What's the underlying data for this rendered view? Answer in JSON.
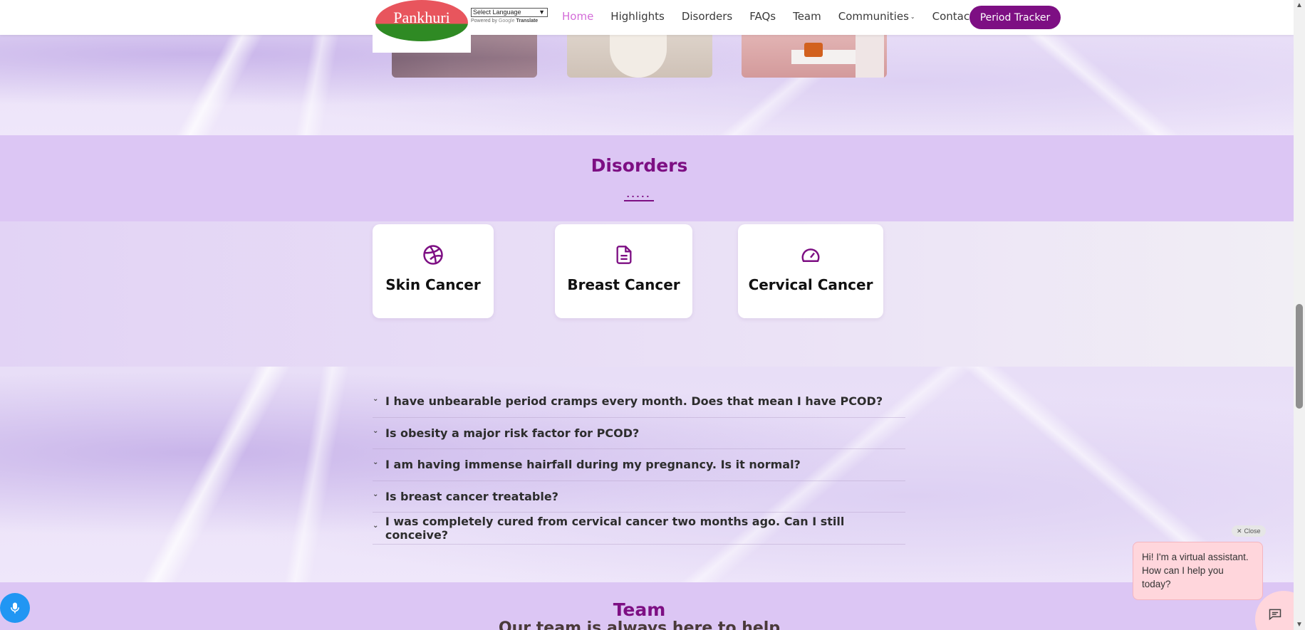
{
  "header": {
    "logo_text": "Pankhuri",
    "translate": {
      "select_label": "Select Language",
      "powered_by": "Powered by",
      "google": "Google",
      "translate": "Translate"
    },
    "nav": [
      {
        "label": "Home",
        "active": true
      },
      {
        "label": "Highlights"
      },
      {
        "label": "Disorders"
      },
      {
        "label": "FAQs"
      },
      {
        "label": "Team"
      },
      {
        "label": "Communities",
        "has_dropdown": true
      },
      {
        "label": "Contact Us"
      }
    ],
    "cta_label": "Period Tracker"
  },
  "colors": {
    "brand": "#7d0f83",
    "active_nav": "#d36bd8",
    "band": "#dcc6f4",
    "mic": "#2196f3",
    "chat_bubble": "#ffd6dc"
  },
  "disorders": {
    "title": "Disorders",
    "dots": ".....",
    "cards": [
      {
        "label": "Skin Cancer",
        "icon": "dribbble-ball-icon"
      },
      {
        "label": "Breast Cancer",
        "icon": "document-icon"
      },
      {
        "label": "Cervical Cancer",
        "icon": "speedometer-icon"
      }
    ]
  },
  "faqs": [
    "I have unbearable period cramps every month. Does that mean I have PCOD?",
    "Is obesity a major risk factor for PCOD?",
    "I am having immense hairfall during my pregnancy. Is it normal?",
    "Is breast cancer treatable?",
    "I was completely cured from cervical cancer two months ago. Can I still conceive?"
  ],
  "team": {
    "title": "Team",
    "subtitle": "Our team is always here to help"
  },
  "chat": {
    "close_label": "Close",
    "message": "Hi! I'm a virtual assistant. How can I help you today?"
  }
}
